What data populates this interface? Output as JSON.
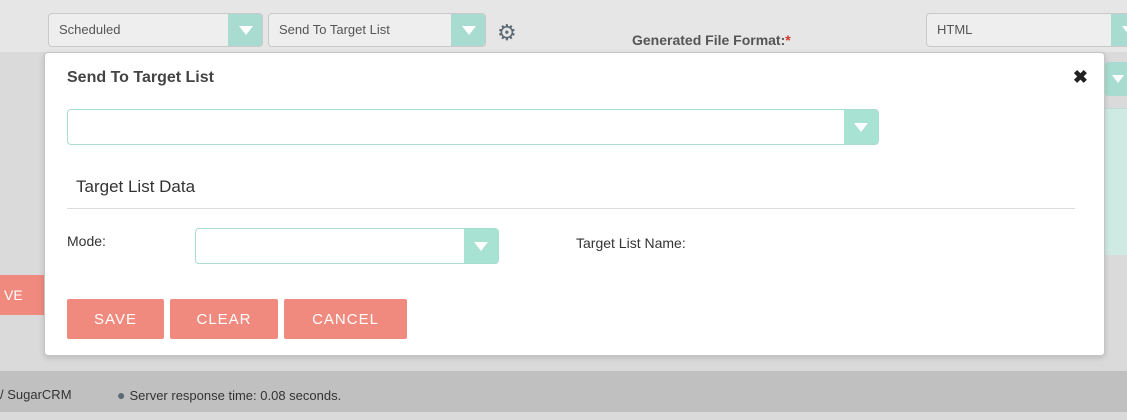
{
  "background": {
    "status_select": "Scheduled",
    "action_select": "Send To Target List",
    "format_label": "Generated File Format:",
    "format_required": "*",
    "format_select": "HTML",
    "partial_button": "VE"
  },
  "modal": {
    "title": "Send To Target List",
    "close_icon": "✖",
    "target_list_select": "",
    "section_title": "Target List Data",
    "mode_label": "Mode:",
    "mode_select": "",
    "target_list_name_label": "Target List Name:",
    "buttons": {
      "save": "SAVE",
      "clear": "CLEAR",
      "cancel": "CANCEL"
    }
  },
  "footer": {
    "powered_by": "/ SugarCRM",
    "server_time": "Server response time: 0.08 seconds."
  },
  "colors": {
    "accent": "#a8dcd0",
    "button": "#f08a7e",
    "required": "#d0352e"
  }
}
